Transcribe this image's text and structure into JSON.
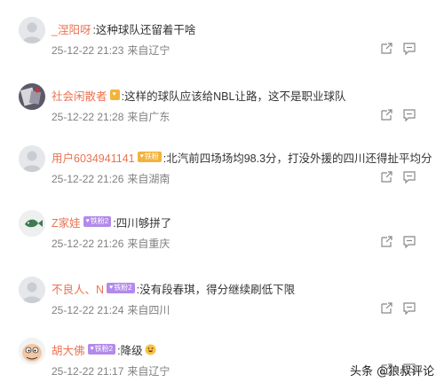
{
  "comments": [
    {
      "username": "_涅阳呀",
      "badge": "",
      "badge_color": "#f3b33b",
      "text": ":这种球队还留着干啥",
      "time": "25-12-22 21:23",
      "location": "来自辽宁",
      "avatar": "default-avatar-icon"
    },
    {
      "username": "社会闲散者",
      "badge": "",
      "badge_color": "#f3b33b",
      "text": ":这样的球队应该给NBL让路，这不是职业球队",
      "time": "25-12-22 21:28",
      "location": "来自广东",
      "avatar": "photo-avatar-icon"
    },
    {
      "username": "用户6034941141",
      "badge": "铁粉",
      "badge_color": "#f3b33b",
      "text": ":北汽前四场场均98.3分，打没外援的四川还得扯平均分",
      "time": "25-12-22 21:26",
      "location": "来自湖南",
      "avatar": "default-avatar-icon"
    },
    {
      "username": "Z家娃",
      "badge": "铁粉2",
      "badge_color": "#b28aeb",
      "text": ":四川够拼了",
      "time": "25-12-22 21:26",
      "location": "来自重庆",
      "avatar": "fish-avatar-icon"
    },
    {
      "username": "不良人、N",
      "badge": "铁粉2",
      "badge_color": "#b28aeb",
      "text": ":没有段春琪，得分继续刷低下限",
      "time": "25-12-22 21:24",
      "location": "来自四川",
      "avatar": "default-avatar-icon"
    },
    {
      "username": "胡大佛",
      "badge": "铁粉2",
      "badge_color": "#b28aeb",
      "text": ":降级",
      "emoji": "grin-emoji-icon",
      "time": "25-12-22 21:17",
      "location": "来自辽宁",
      "avatar": "cartoon-avatar-icon"
    }
  ],
  "actions": {
    "share_icon": "share-icon",
    "comment_icon": "comment-icon"
  },
  "watermark": {
    "platform": "头条",
    "handle": "@狼叔评论"
  }
}
